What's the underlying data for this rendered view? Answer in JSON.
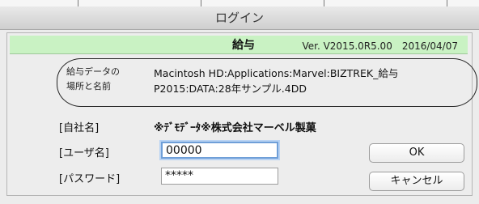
{
  "window": {
    "title": "ログイン"
  },
  "banner": {
    "app_name": "給与",
    "version_text": "Ver. V2015.0R5.00　2016/04/07",
    "color": "#c9f2c3"
  },
  "data_location": {
    "label_line1": "給与データの",
    "label_line2": "場所と名前",
    "path_line1": "Macintosh HD:Applications:Marvel:BIZTREK_給与",
    "path_line2": "P2015:DATA:28年サンプル.4DD"
  },
  "form": {
    "company_label": "[自社名]",
    "company_value": "※ﾃﾞﾓﾃﾞｰﾀ※株式会社マーベル製菓",
    "user_label": "[ユーザ名]",
    "user_value": "00000",
    "password_label": "[パスワード]",
    "password_value": "*****"
  },
  "buttons": {
    "ok_label": "OK",
    "cancel_label": "キャンセル"
  }
}
